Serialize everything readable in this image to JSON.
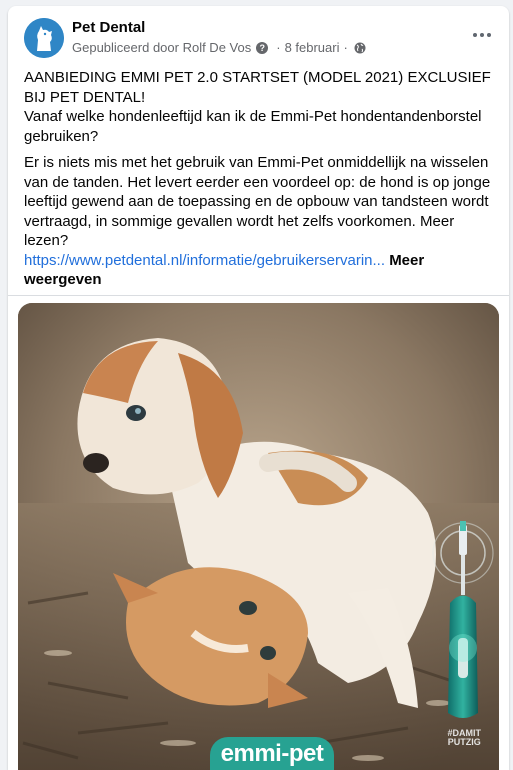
{
  "post": {
    "page_name": "Pet Dental",
    "published_by": "Gepubliceerd door Rolf De Vos",
    "help_glyph": "?",
    "date": "8 februari",
    "privacy_icon": "globe-icon",
    "more_icon": "more-options-icon"
  },
  "content": {
    "headline": "AANBIEDING EMMI PET 2.0 STARTSET (MODEL 2021) EXCLUSIEF BIJ PET DENTAL!",
    "question": "Vanaf welke hondenleeftijd kan ik de Emmi-Pet hondentandenborstel gebruiken?",
    "body": "Er is niets mis met het gebruik van Emmi-Pet onmiddellijk na wisselen van de tanden. Het levert eerder een voordeel op: de hond is op jonge leeftijd gewend aan de toepassing en de opbouw van tandsteen wordt vertraagd, in sommige gevallen wordt het zelfs voorkomen. Meer lezen?",
    "link": "https://www.petdental.nl/informatie/gebruikerservarin...",
    "see_more": "Meer weergeven"
  },
  "image": {
    "subject": "puppy and kitten playing on forest ground with Emmi-Pet toothbrush",
    "brand_text": "emmi-pet",
    "hashtag_line1": "#DAMIT",
    "hashtag_line2": "PUTZIG"
  },
  "colors": {
    "link": "#216fdb",
    "brand": "#27a292",
    "avatar_bg": "#2f86c6"
  }
}
